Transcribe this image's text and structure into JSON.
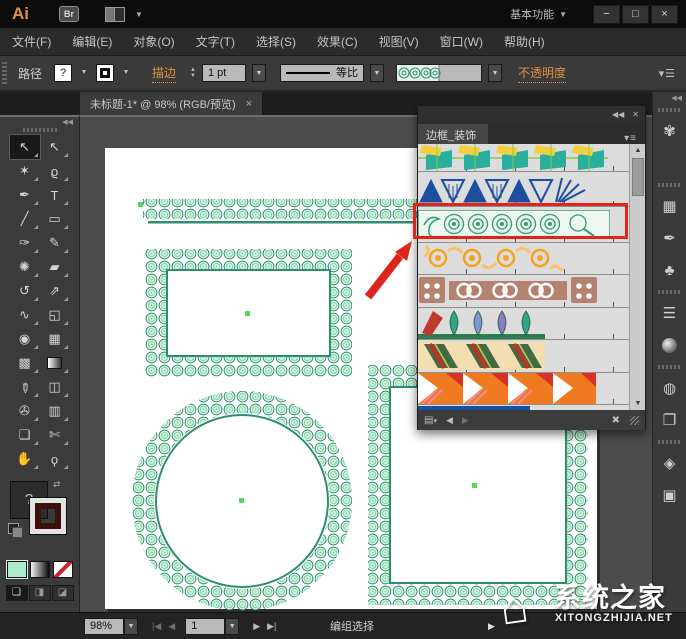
{
  "colors": {
    "accent_orange": "#e0923f",
    "red": "#dd241d",
    "mint": "#abeccd",
    "panel_bg": "#dcdcdc",
    "ornament_green": "#2e8f6e",
    "ornament_light": "#8cdcab",
    "dot_green": "#57d657",
    "navy": "#1d4f9e",
    "brush_orange": "#f5a31f",
    "brush_brown": "#b5826f",
    "ribbon_green": "#3f6c45",
    "quilt_orange": "#f07a22"
  },
  "window": {
    "logo": "Ai",
    "bridge": "Br",
    "workspace": "基本功能",
    "minimize": "−",
    "maximize": "□",
    "close": "×"
  },
  "menubar": {
    "items": [
      "文件(F)",
      "编辑(E)",
      "对象(O)",
      "文字(T)",
      "选择(S)",
      "效果(C)",
      "视图(V)",
      "窗口(W)",
      "帮助(H)"
    ]
  },
  "controlbar": {
    "label": "路径",
    "fill_indicator": "?",
    "stroke_label": "描边",
    "stroke_value": "1 pt",
    "profile": "等比",
    "opacity_label": "不透明度"
  },
  "tabbar": {
    "document": "未标题-1* @ 98% (RGB/预览)",
    "close": "×"
  },
  "toolbar": {
    "tools": [
      {
        "name": "selection-tool",
        "glyph": "↖",
        "active": true
      },
      {
        "name": "direct-selection-tool",
        "glyph": "↖"
      },
      {
        "name": "magic-wand-tool",
        "glyph": "✶"
      },
      {
        "name": "lasso-tool",
        "glyph": "ϱ"
      },
      {
        "name": "pen-tool",
        "glyph": "✒"
      },
      {
        "name": "type-tool",
        "glyph": "T"
      },
      {
        "name": "line-segment-tool",
        "glyph": "╱"
      },
      {
        "name": "rectangle-tool",
        "glyph": "▭"
      },
      {
        "name": "paintbrush-tool",
        "glyph": "✑"
      },
      {
        "name": "pencil-tool",
        "glyph": "✎"
      },
      {
        "name": "blob-brush-tool",
        "glyph": "✺"
      },
      {
        "name": "eraser-tool",
        "glyph": "▰"
      },
      {
        "name": "rotate-tool",
        "glyph": "↺"
      },
      {
        "name": "scale-tool",
        "glyph": "⇗"
      },
      {
        "name": "width-tool",
        "glyph": "∿"
      },
      {
        "name": "free-transform-tool",
        "glyph": "◱"
      },
      {
        "name": "shape-builder-tool",
        "glyph": "◉"
      },
      {
        "name": "perspective-grid-tool",
        "glyph": "▦"
      },
      {
        "name": "mesh-tool",
        "glyph": "▩"
      },
      {
        "name": "gradient-tool",
        "type": "gradient"
      },
      {
        "name": "eyedropper-tool",
        "glyph": "✐",
        "rotated": true
      },
      {
        "name": "blend-tool",
        "glyph": "◫"
      },
      {
        "name": "symbol-sprayer-tool",
        "glyph": "✇"
      },
      {
        "name": "graph-tool",
        "glyph": "▥"
      },
      {
        "name": "artboard-tool",
        "glyph": "❏"
      },
      {
        "name": "slice-tool",
        "glyph": "✄"
      },
      {
        "name": "hand-tool",
        "glyph": "✋"
      },
      {
        "name": "zoom-tool",
        "glyph": "ϙ"
      }
    ]
  },
  "dock": {
    "expand": "◀◀",
    "items": [
      {
        "name": "color-panel-icon",
        "glyph": "✾"
      },
      {
        "name": "gradient-panel-icon",
        "type": "quarter"
      },
      {
        "name": "grip",
        "type": "grip"
      },
      {
        "name": "swatches-panel-icon",
        "glyph": "▦"
      },
      {
        "name": "brushes-panel-icon",
        "glyph": "✒"
      },
      {
        "name": "symbols-panel-icon",
        "glyph": "♣"
      },
      {
        "name": "grip",
        "type": "grip"
      },
      {
        "name": "stroke-panel-icon",
        "glyph": "☰"
      },
      {
        "name": "gradient-sphere-icon",
        "type": "sphere"
      },
      {
        "name": "grip",
        "type": "grip"
      },
      {
        "name": "transparency-panel-icon",
        "glyph": "◍"
      },
      {
        "name": "transform-panel-icon",
        "glyph": "❐"
      },
      {
        "name": "grip",
        "type": "grip"
      },
      {
        "name": "layers-panel-icon",
        "glyph": "◈"
      },
      {
        "name": "artboards-panel-icon",
        "glyph": "▣"
      }
    ]
  },
  "panel": {
    "collapse": "◀◀",
    "close": "✕",
    "title": "边框_装饰",
    "menu": "▾≡",
    "rows": [
      {
        "name": "teal-yellow-geometric"
      },
      {
        "name": "blue-zigzag-ribbon"
      },
      {
        "name": "green-ornament",
        "highlighted": true
      },
      {
        "name": "orange-scroll"
      },
      {
        "name": "brown-rope"
      },
      {
        "name": "color-petals"
      },
      {
        "name": "green-red-ribbon"
      },
      {
        "name": "orange-quilt"
      },
      {
        "name": "blue-strip-partial"
      }
    ],
    "footer": {
      "library": "▤",
      "library_caret": "▾",
      "prev": "◀",
      "next": "▶",
      "remove": "✖"
    },
    "scroll_up": "▲",
    "scroll_down": "▼"
  },
  "statusbar": {
    "zoom": "98%",
    "first": "|◀",
    "prev": "◀",
    "artboard": "1",
    "next": "▶",
    "last": "▶|",
    "status": "编组选择",
    "more": "▶",
    "caret": "▼"
  },
  "watermark": {
    "house": "⌂",
    "title": "系统之家",
    "domain": "XITONGZHIJIA.NET"
  }
}
